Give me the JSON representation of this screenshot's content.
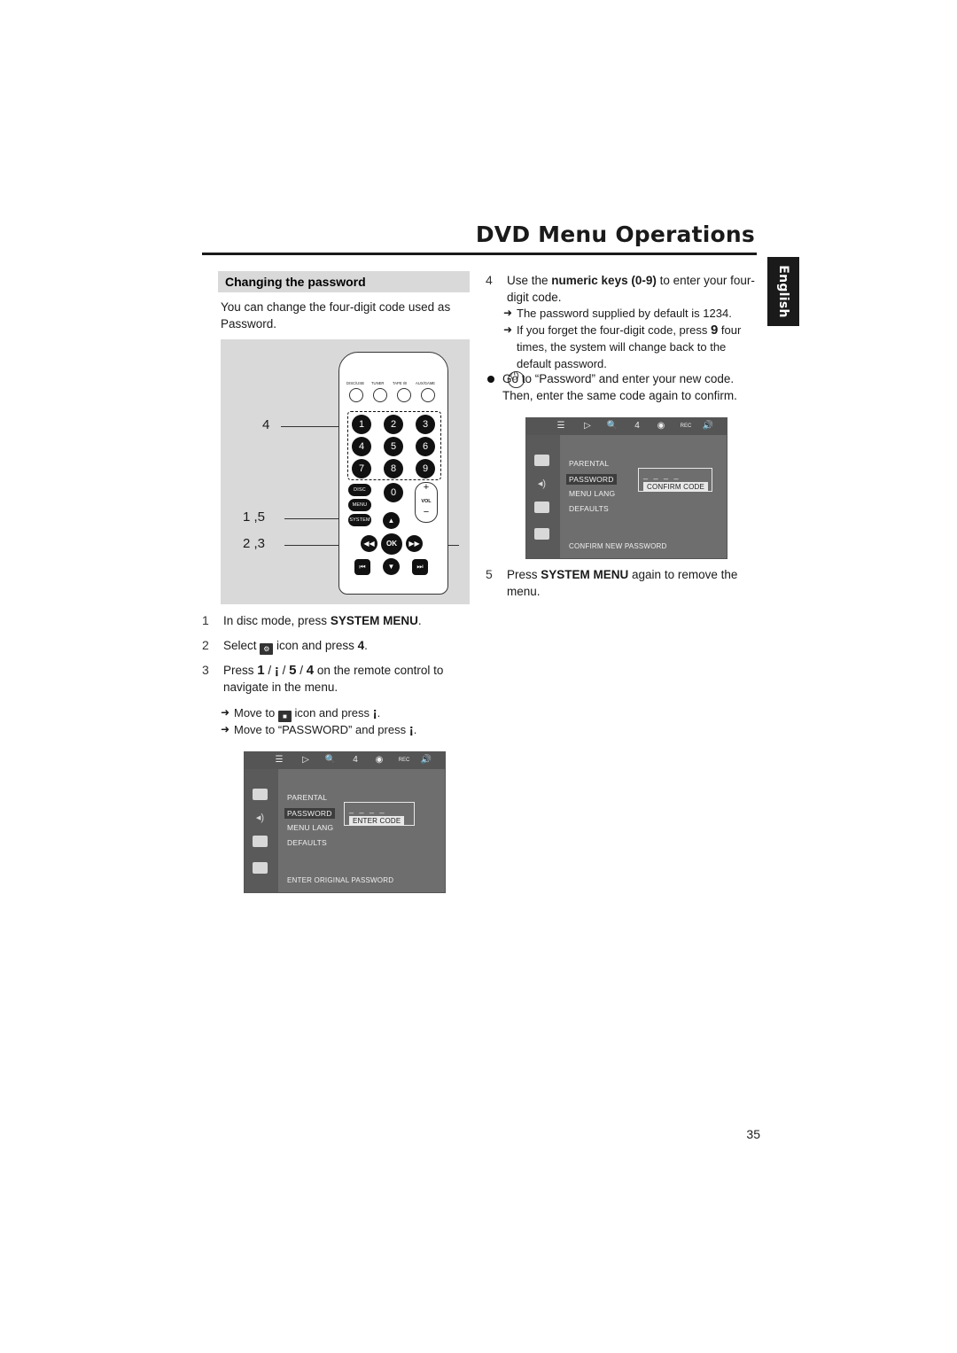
{
  "header": {
    "title": "DVD Menu Operations",
    "side_tab": "English"
  },
  "section": {
    "heading": "Changing the password",
    "intro": "You can change the four-digit code used as Password."
  },
  "remote": {
    "callouts": {
      "c4": "4",
      "c15": "1 ,5",
      "c23": "2 ,3"
    },
    "source_labels": [
      "DISC/USB",
      "TUNER",
      "TAPE I/II",
      "AUX/GAME"
    ],
    "keys": [
      "1",
      "2",
      "3",
      "4",
      "5",
      "6",
      "7",
      "8",
      "9",
      "0"
    ],
    "disc_label": "DISC",
    "menu_label": "MENU",
    "system_label": "SYSTEM",
    "vol_label": "VOL",
    "vol_plus": "+",
    "vol_minus": "−",
    "ok_label": "OK"
  },
  "steps_left": [
    {
      "num": "1",
      "text_pre": "In disc mode, press ",
      "bold": "SYSTEM MENU",
      "text_post": "."
    },
    {
      "num": "2",
      "text_pre": "Select ",
      "icon": "setup-icon",
      "text_mid": " icon and press ",
      "bold": "4",
      "text_post": "."
    },
    {
      "num": "3",
      "text_pre": "Press ",
      "bold1": "1",
      "sep1": " / ",
      "bold2": "¡",
      "sep2": " / ",
      "bold3": "5",
      "sep3": " / ",
      "bold4": "4",
      "text_post": " on the remote control to navigate in the menu."
    }
  ],
  "sub_items_left": [
    {
      "arrow": "➜",
      "pre": "Move to ",
      "icon": "password-icon",
      "mid": " icon and press ",
      "bold": "¡",
      "post": "."
    },
    {
      "arrow": "➜",
      "pre": "Move to “PASSWORD” and press ",
      "bold": "¡",
      "post": "."
    }
  ],
  "steps_right": [
    {
      "num": "4",
      "pre": "Use the ",
      "bold": "numeric keys (0-9)",
      "post": " to enter your four-digit code."
    },
    {
      "num": "5",
      "pre": "Press ",
      "bold": "SYSTEM MENU",
      "post": " again to remove the menu."
    }
  ],
  "sub_items_right": [
    {
      "arrow": "➜",
      "text": "The password supplied by default is 1234."
    },
    {
      "arrow": "➜",
      "pre": "If you forget the four-digit code, press ",
      "bold": "9",
      "post": " four times, the system will change back to the default password."
    }
  ],
  "bullet_right": {
    "dot": "●",
    "text": "Go to “Password” and enter your new code. Then, enter the same code again to confirm."
  },
  "osd_top": {
    "toolbar_icons": [
      "setup-icon",
      "playback-icon",
      "search-icon",
      "audio-icon",
      "display-icon",
      "rec-icon",
      "volume-icon"
    ],
    "rec_label": "REC",
    "menu_items": [
      "PARENTAL",
      "PASSWORD",
      "MENU LANG",
      "DEFAULTS"
    ],
    "selected_item": "PASSWORD",
    "code_label": "CONFIRM CODE",
    "dashes": "_ _ _ _",
    "status": "CONFIRM NEW PASSWORD"
  },
  "osd_bottom": {
    "toolbar_icons": [
      "setup-icon",
      "playback-icon",
      "search-icon",
      "audio-icon",
      "display-icon",
      "rec-icon",
      "volume-icon"
    ],
    "rec_label": "REC",
    "menu_items": [
      "PARENTAL",
      "PASSWORD",
      "MENU LANG",
      "DEFAULTS"
    ],
    "selected_item": "PASSWORD",
    "code_label": "ENTER CODE",
    "dashes": "_ _ _ _",
    "status": "ENTER ORIGINAL PASSWORD"
  },
  "page_number": "35"
}
